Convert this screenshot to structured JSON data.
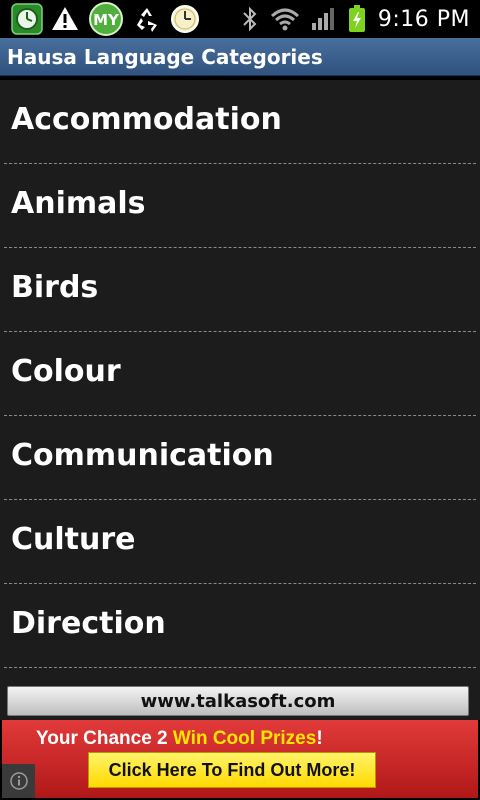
{
  "status_bar": {
    "time": "9:16 PM",
    "left_icons": [
      "clock-app-icon",
      "warning-icon",
      "my-app-icon",
      "recycle-icon",
      "alarm-clock-icon"
    ],
    "my_badge_text": "MY",
    "right_icons": [
      "bluetooth-icon",
      "wifi-icon",
      "signal-icon",
      "battery-charging-icon"
    ]
  },
  "title_bar": {
    "title": "Hausa Language Categories"
  },
  "categories": [
    {
      "label": "Accommodation"
    },
    {
      "label": "Animals"
    },
    {
      "label": "Birds"
    },
    {
      "label": "Colour"
    },
    {
      "label": "Communication"
    },
    {
      "label": "Culture"
    },
    {
      "label": "Direction"
    }
  ],
  "footer": {
    "site_label": "www.talkasoft.com"
  },
  "ad": {
    "line1_prefix": "Your Chance 2 ",
    "line1_highlight": "Win Cool Prizes",
    "line1_suffix": "!",
    "cta_label": "Click Here To Find Out More!",
    "colors": {
      "background": "#d42626",
      "highlight": "#ffe600",
      "cta": "#ffe600"
    }
  },
  "colors": {
    "title_bar": "#3d6290",
    "list_background": "#1c1c1c",
    "divider": "#8a8a8a"
  }
}
